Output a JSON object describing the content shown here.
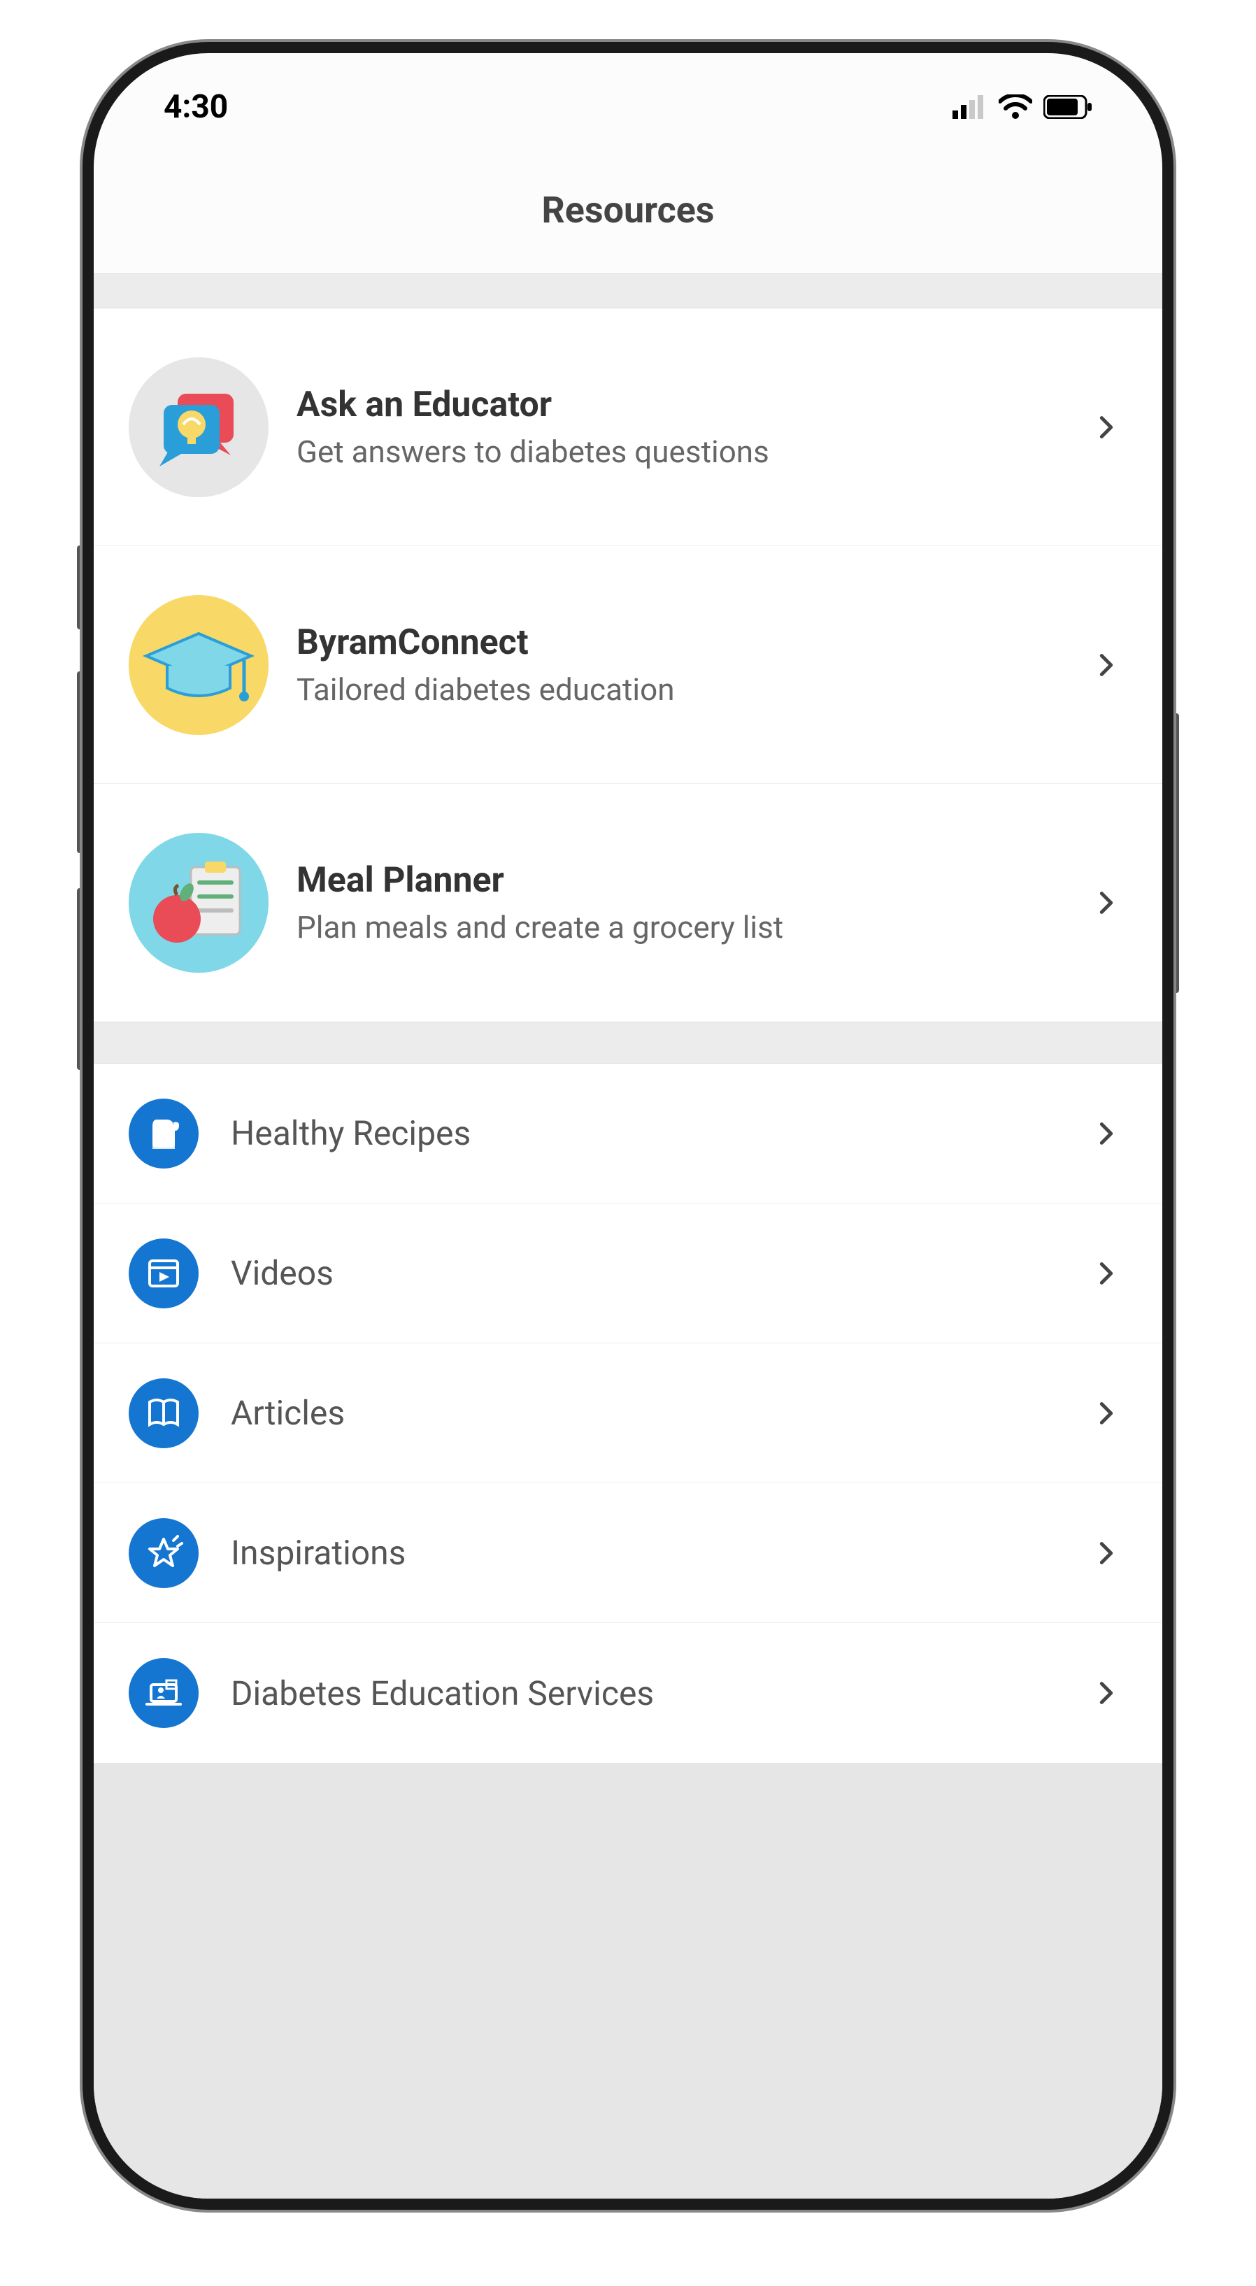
{
  "status": {
    "time": "4:30"
  },
  "header": {
    "title": "Resources"
  },
  "featured": [
    {
      "title": "Ask an Educator",
      "subtitle": "Get answers to diabetes questions"
    },
    {
      "title": "ByramConnect",
      "subtitle": "Tailored diabetes education"
    },
    {
      "title": "Meal Planner",
      "subtitle": "Plan meals and create a grocery list"
    }
  ],
  "simple": [
    {
      "label": "Healthy Recipes"
    },
    {
      "label": "Videos"
    },
    {
      "label": "Articles"
    },
    {
      "label": "Inspirations"
    },
    {
      "label": "Diabetes Education Services"
    }
  ]
}
